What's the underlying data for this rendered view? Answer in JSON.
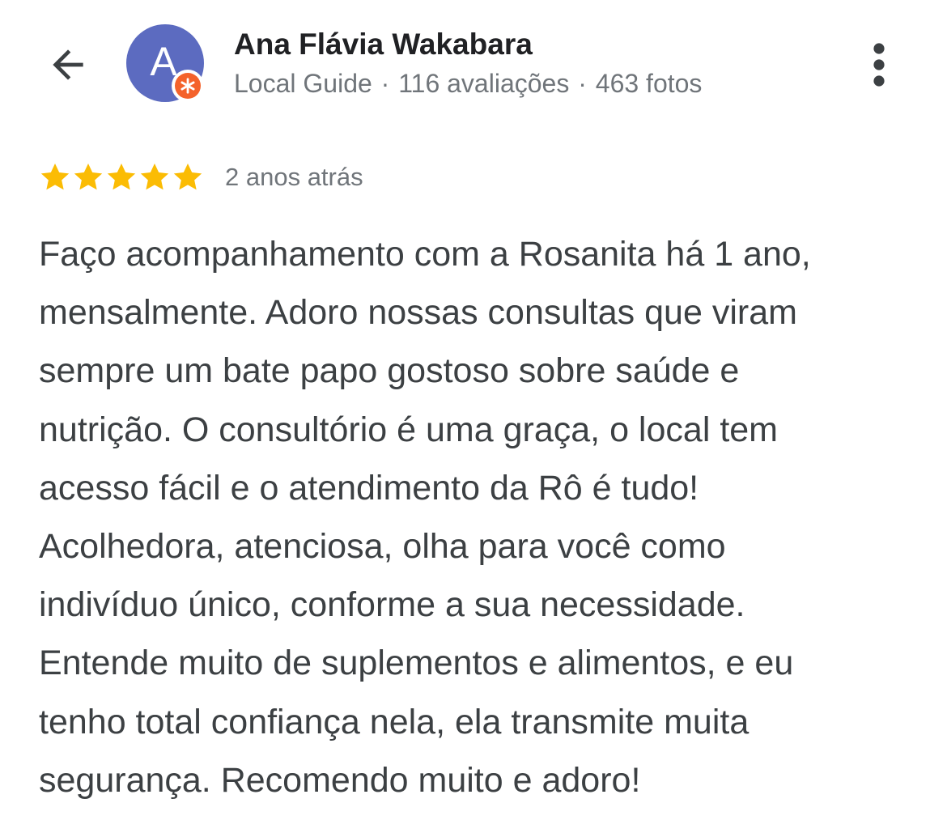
{
  "header": {
    "back_icon": "arrow-back-icon",
    "avatar_letter": "A",
    "avatar_color": "#5c6bc0",
    "badge_icon": "local-guide-badge-icon",
    "badge_color": "#f4622b",
    "name": "Ana Flávia Wakabara",
    "meta": {
      "level": "Local Guide",
      "reviews": "116 avaliações",
      "photos": "463 fotos",
      "separator": "·"
    },
    "more_icon": "more-vert-icon"
  },
  "review": {
    "rating": 5,
    "max_rating": 5,
    "star_color": "#fbbc04",
    "time": "2 anos atrás",
    "lines": [
      "Faço acompanhamento com a Rosanita há 1 ano,",
      "mensalmente. Adoro nossas consultas que viram",
      "sempre um bate papo gostoso sobre saúde e",
      "nutrição. O consultório é uma graça, o local tem",
      "acesso fácil e o atendimento da Rô é tudo!",
      "Acolhedora, atenciosa, olha para você como",
      "indivíduo único, conforme a sua necessidade.",
      "Entende muito de suplementos e alimentos, e eu",
      "tenho total confiança nela, ela transmite muita",
      "segurança. Recomendo muito e adoro!"
    ]
  }
}
